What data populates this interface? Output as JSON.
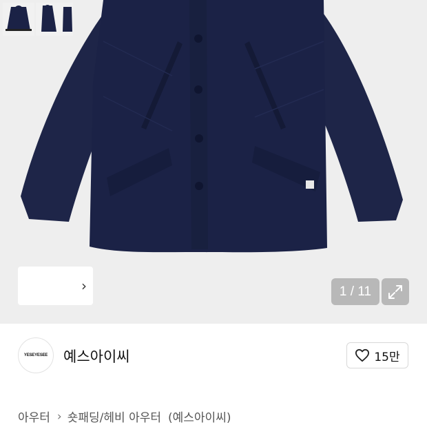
{
  "gallery": {
    "counter": "1 / 11",
    "thumbnails": [
      "jacket-front",
      "jacket-side",
      "jacket-back"
    ],
    "colors": {
      "background": "#eeeeee",
      "jacket": "#1c2347"
    }
  },
  "brand": {
    "logo_text": "YESEYESEE",
    "name": "예스아이씨",
    "likes": "15만"
  },
  "breadcrumb": {
    "category": "아우터",
    "subcategory": "숏패딩/헤비 아우터",
    "brand": "(예스아이씨)"
  },
  "icons": [
    "chevron-right-icon",
    "expand-icon",
    "heart-icon"
  ]
}
